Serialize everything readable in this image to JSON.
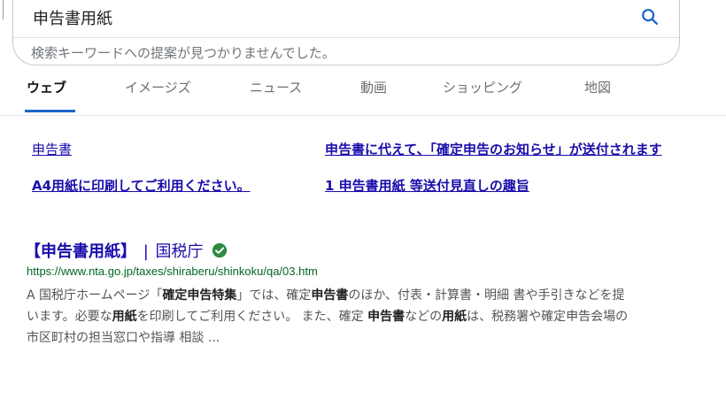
{
  "search": {
    "query": "申告書用紙",
    "no_suggestion": "検索キーワードへの提案が見つかりませんでした。"
  },
  "tabs": [
    {
      "label": "ウェブ",
      "active": true
    },
    {
      "label": "イメージズ",
      "active": false
    },
    {
      "label": "ニュース",
      "active": false
    },
    {
      "label": "動画",
      "active": false
    },
    {
      "label": "ショッピング",
      "active": false
    },
    {
      "label": "地図",
      "active": false
    }
  ],
  "related": [
    "申告書",
    "申告書に代えて、「確定申告のお知らせ」が送付されます",
    "A4用紙に印刷してご利用ください。",
    "1 申告書用紙 等送付見直しの趣旨"
  ],
  "result": {
    "title_main": "【申告書用紙】",
    "title_sep": "|",
    "title_site": "国税庁",
    "url": "https://www.nta.go.jp/taxes/shiraberu/shinkoku/qa/03.htm",
    "snippet_line1_a": "A 国税庁ホームページ「",
    "snippet_line1_b": "確定申告特集",
    "snippet_line1_c": "」では、確定",
    "snippet_line1_d": "申告書",
    "snippet_line1_e": "のほか、付表・計算書・明細 書や手引きなどを提",
    "snippet_line2_a": "います。必要な",
    "snippet_line2_b": "用紙",
    "snippet_line2_c": "を印刷してご利用ください。 また、確定 ",
    "snippet_line2_d": "申告書",
    "snippet_line2_e": "などの",
    "snippet_line2_f": "用紙",
    "snippet_line2_g": "は、税務署や確定申告会場の",
    "snippet_line3": "市区町村の担当窓口や指導 相談 ..."
  },
  "colors": {
    "link": "#1a0dab",
    "url": "#006621",
    "tab_active_underline": "#1b66c9",
    "verified": "#2e8b3e"
  },
  "icons": [
    "search-icon",
    "verified-check-icon"
  ]
}
